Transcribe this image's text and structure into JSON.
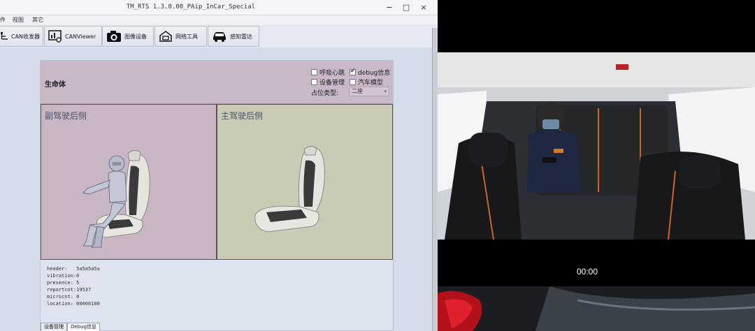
{
  "window": {
    "title": "TM_RTS 1.3.0.00_PAip_InCar_Special",
    "minimize": "−",
    "maximize": "□",
    "close": "×"
  },
  "menu": [
    "件",
    "视图",
    "其它"
  ],
  "toolbar": [
    {
      "label": "CAN收发器",
      "icon": "can-transceiver-icon"
    },
    {
      "label": "CANViewer",
      "icon": "can-viewer-icon"
    },
    {
      "label": "图像设备",
      "icon": "camera-icon"
    },
    {
      "label": "网络工具",
      "icon": "network-tool-icon"
    },
    {
      "label": "感知雷达",
      "icon": "car-radar-icon"
    }
  ],
  "life": {
    "title": "生命体",
    "options": [
      {
        "label": "呼吸心跳",
        "checked": false
      },
      {
        "label": "debug信息",
        "checked": true
      },
      {
        "label": "设备管理",
        "checked": false
      },
      {
        "label": "汽车模型",
        "checked": false
      }
    ],
    "seat_type_label": "占位类型:",
    "seat_type_value": "二座"
  },
  "zones": {
    "left_title": "副驾驶后侧",
    "right_title": "主驾驶后侧"
  },
  "debug": [
    "header:   5a5a5a5a",
    "vibration:0",
    "presence: 5",
    "reportcnt:19537",
    "microcnt: 0",
    "location: 00000100"
  ],
  "tabs": [
    "设备管理",
    "Debug信息"
  ],
  "video": {
    "time": "00:00"
  },
  "colors": {
    "header_bg": "#c9b9c8",
    "left_zone_bg": "#c8b6c4",
    "right_zone_bg": "#c9cbb5"
  }
}
